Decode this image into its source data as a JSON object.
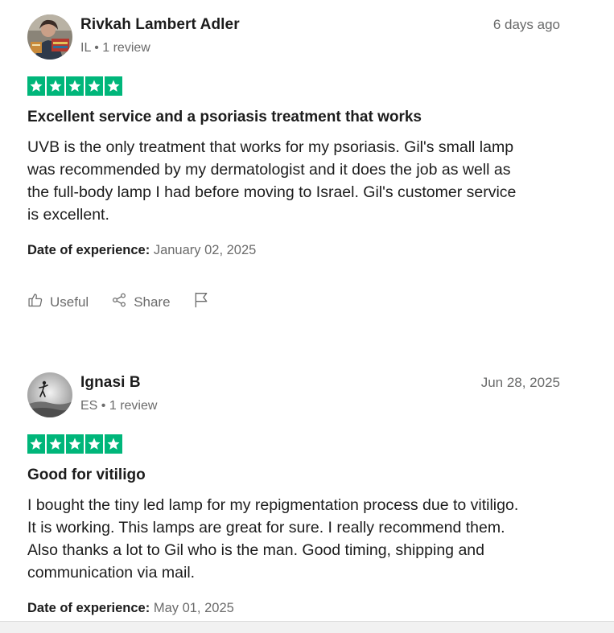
{
  "colors": {
    "star_green": "#00b67a",
    "text_dark": "#1c1c1c",
    "text_muted": "#6b6b6b"
  },
  "reviews": [
    {
      "name": "Rivkah Lambert Adler",
      "country": "IL",
      "review_count": "1 review",
      "date": "6 days ago",
      "rating": 5,
      "title": "Excellent service and a psoriasis treatment that works",
      "body_lines": [
        "UVB is the only treatment that works for my psoriasis. Gil's small lamp",
        "was recommended by my dermatologist and it does the job as well as",
        "the full-body lamp I had before moving to Israel. Gil's customer service",
        "is excellent."
      ],
      "experience_label": "Date of experience:",
      "experience_date": "January 02, 2025",
      "actions": {
        "useful": "Useful",
        "share": "Share"
      }
    },
    {
      "name": "Ignasi B",
      "country": "ES",
      "review_count": "1 review",
      "date": "Jun 28, 2025",
      "rating": 5,
      "title": "Good for vitiligo",
      "body_lines": [
        "I bought the tiny led lamp for my repigmentation process due to vitiligo.",
        "It is working. This lamps are great for sure. I really recommend them.",
        "Also thanks a lot to Gil who is the man. Good timing, shipping and",
        "communication via mail."
      ],
      "experience_label": "Date of experience:",
      "experience_date": "May 01, 2025"
    }
  ]
}
